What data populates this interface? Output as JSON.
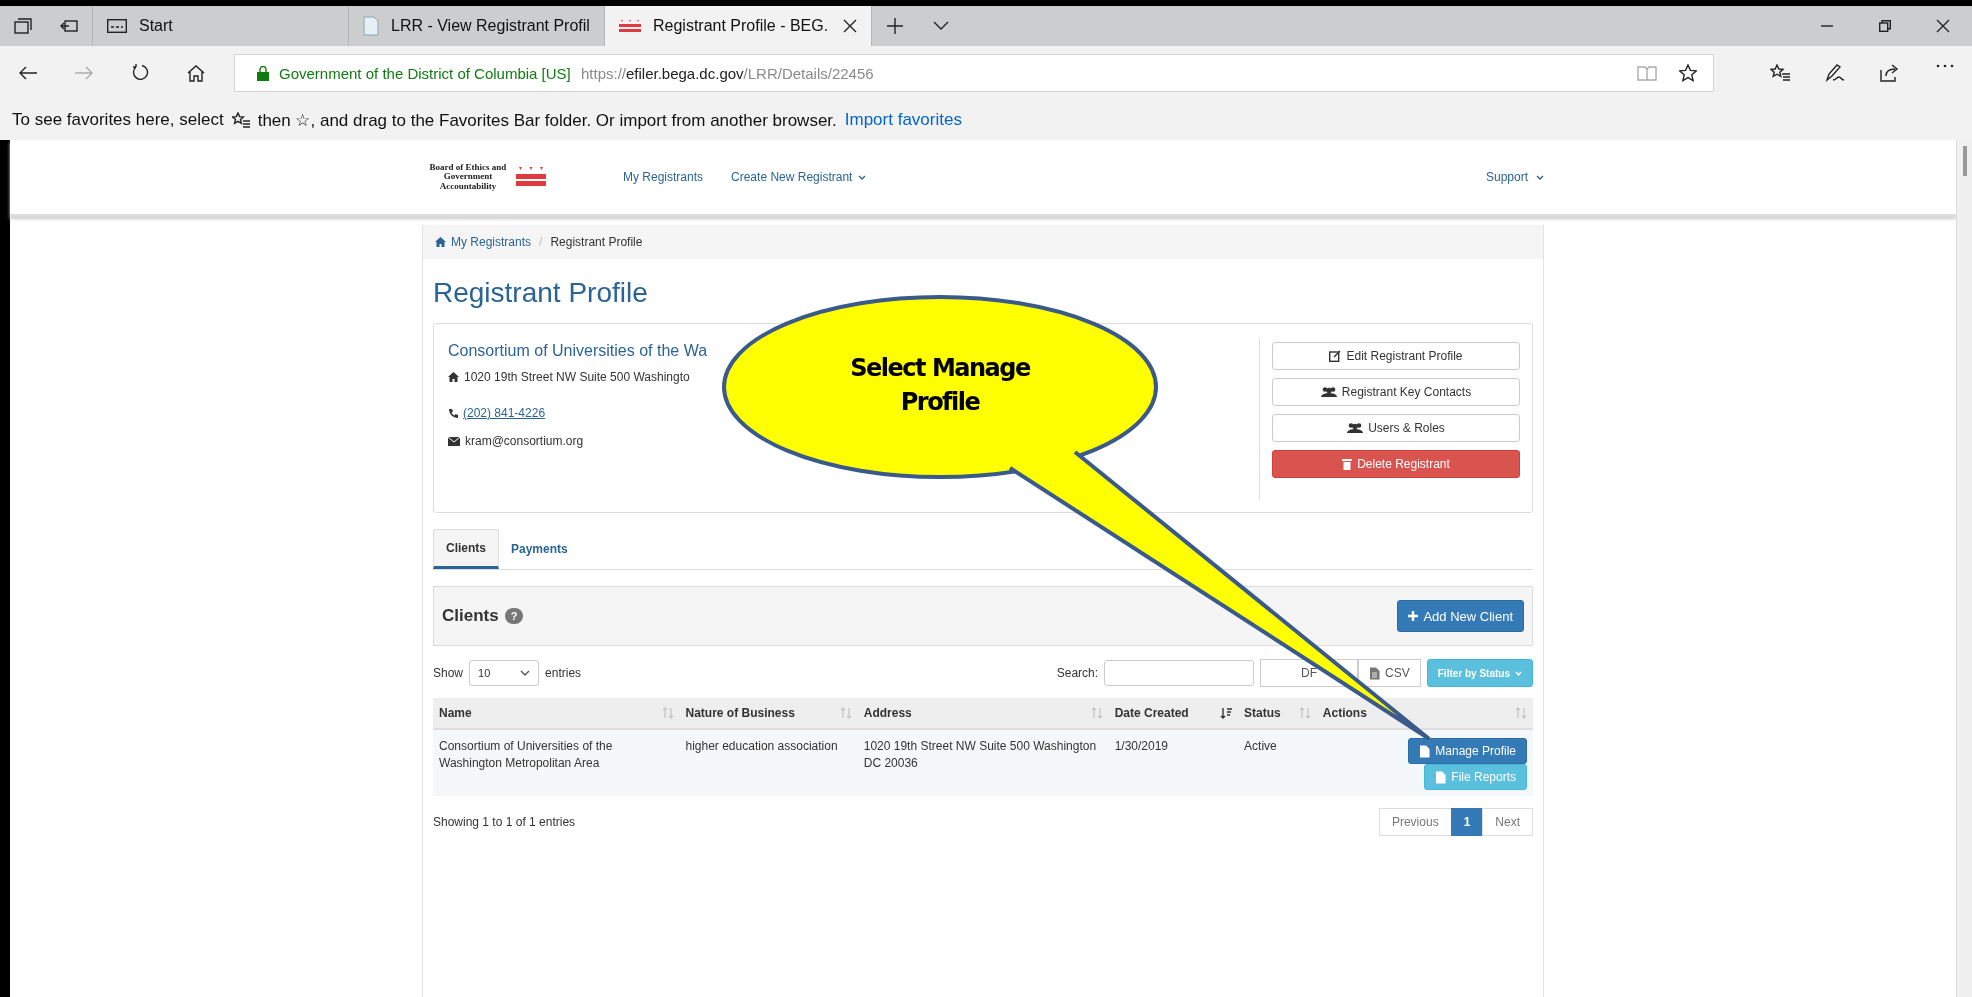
{
  "browser": {
    "tabs": [
      {
        "title": "Start",
        "kind": "start",
        "selected": false
      },
      {
        "title": "LRR - View Registrant Profil",
        "kind": "document",
        "selected": false
      },
      {
        "title": "Registrant Profile - BEG.",
        "kind": "flag",
        "selected": true
      }
    ]
  },
  "address_bar": {
    "site_identity": "Government of the District of Columbia [US]",
    "url_prefix": "https://",
    "url_host": "efiler.bega.dc.gov",
    "url_path": "/LRR/Details/22456"
  },
  "favorites_bar": {
    "text_before": "To see favorites here, select",
    "text_after": "then ☆, and drag to the Favorites Bar folder. Or import from another browser.",
    "link": "Import favorites"
  },
  "site_nav": {
    "logo_text": "Board of Ethics and Government Accountability",
    "items": [
      {
        "label": "My Registrants",
        "dropdown": false
      },
      {
        "label": "Create New Registrant",
        "dropdown": true
      }
    ],
    "support": "Support"
  },
  "breadcrumb": {
    "separator": "/",
    "items": [
      {
        "label": "My Registrants",
        "link": true
      },
      {
        "label": "Registrant Profile",
        "link": false
      }
    ]
  },
  "title": "Registrant Profile",
  "profile": {
    "name": "Consortium of Universities of the Wa",
    "address": "1020 19th Street NW Suite 500 Washingto",
    "phone": "(202) 841-4226",
    "email": "kram@consortium.org",
    "actions": [
      {
        "label": "Edit Registrant Profile",
        "kind": "default"
      },
      {
        "label": "Registrant Key Contacts",
        "kind": "default"
      },
      {
        "label": "Users & Roles",
        "kind": "default"
      },
      {
        "label": "Delete Registrant",
        "kind": "danger"
      }
    ]
  },
  "tabs": [
    {
      "label": "Clients",
      "selected": true
    },
    {
      "label": "Payments",
      "selected": false
    }
  ],
  "clients_panel": {
    "title": "Clients",
    "help": "?",
    "add_button": "Add New Client"
  },
  "table_controls": {
    "show_label": "Show",
    "page_size": "10",
    "entries_label": "entries",
    "search_label": "Search:",
    "export_buttons": [
      {
        "label": "DF",
        "kind": "text"
      },
      {
        "label": "CSV",
        "kind": "icon"
      }
    ],
    "filter_button": "Filter by Status"
  },
  "table": {
    "columns": [
      {
        "label": "Name",
        "sorted": false
      },
      {
        "label": "Nature of Business",
        "sorted": false
      },
      {
        "label": "Address",
        "sorted": false
      },
      {
        "label": "Date Created",
        "sorted": true
      },
      {
        "label": "Status",
        "sorted": false
      },
      {
        "label": "Actions",
        "sorted": false
      }
    ],
    "rows": [
      {
        "cells": [
          "Consortium of Universities of the Washington Metropolitan Area",
          "higher education association",
          "1020 19th Street NW Suite 500 Washington DC 20036",
          "1/30/2019",
          "Active"
        ],
        "actions": [
          {
            "label": "Manage Profile",
            "kind": "primary"
          },
          {
            "label": "File Reports",
            "kind": "info"
          }
        ]
      }
    ]
  },
  "footer": {
    "summary": "Showing 1 to 1 of 1 entries",
    "pagination": [
      {
        "label": "Previous",
        "selected": false
      },
      {
        "label": "1",
        "selected": true
      },
      {
        "label": "Next",
        "selected": false
      }
    ]
  },
  "callout": {
    "text": "Select Manage Profile"
  }
}
